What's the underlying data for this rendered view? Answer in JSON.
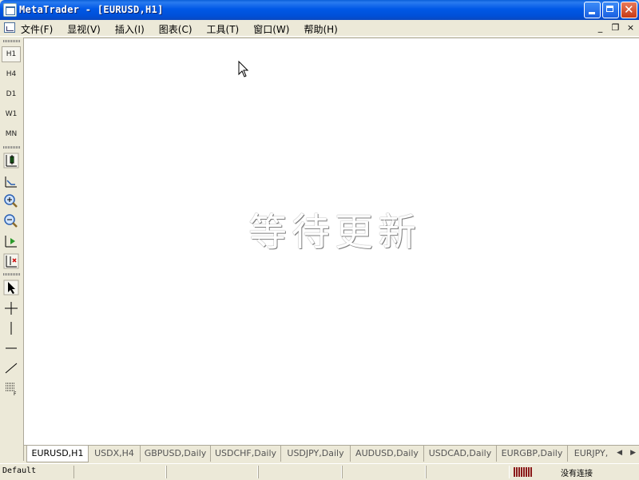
{
  "window": {
    "title": "MetaTrader - [EURUSD,H1]"
  },
  "menu": {
    "items": [
      "文件(F)",
      "显视(V)",
      "插入(I)",
      "图表(C)",
      "工具(T)",
      "窗口(W)",
      "帮助(H)"
    ]
  },
  "mdi_buttons": {
    "minimize": "_",
    "restore": "❐",
    "close": "×"
  },
  "timeframes": [
    "H1",
    "H4",
    "D1",
    "W1",
    "MN"
  ],
  "tools": [
    "chart-bars-icon",
    "chart-shift-icon",
    "zoom-in-icon",
    "zoom-out-icon",
    "autoscroll-icon",
    "crosshair-period-icon",
    "cursor-icon",
    "crosshair-icon",
    "vertical-line-icon",
    "horizontal-line-icon",
    "trendline-icon",
    "fibonacci-icon"
  ],
  "chart": {
    "waiting_text": "等待更新"
  },
  "tabs": [
    "EURUSD,H1",
    "USDX,H4",
    "GBPUSD,Daily",
    "USDCHF,Daily",
    "USDJPY,Daily",
    "AUDUSD,Daily",
    "USDCAD,Daily",
    "EURGBP,Daily",
    "EURJPY,"
  ],
  "status": {
    "profile": "Default",
    "connection": "没有连接"
  },
  "colors": {
    "title_bar": "#0058e6",
    "connection_bars": "#8b1a1a"
  }
}
